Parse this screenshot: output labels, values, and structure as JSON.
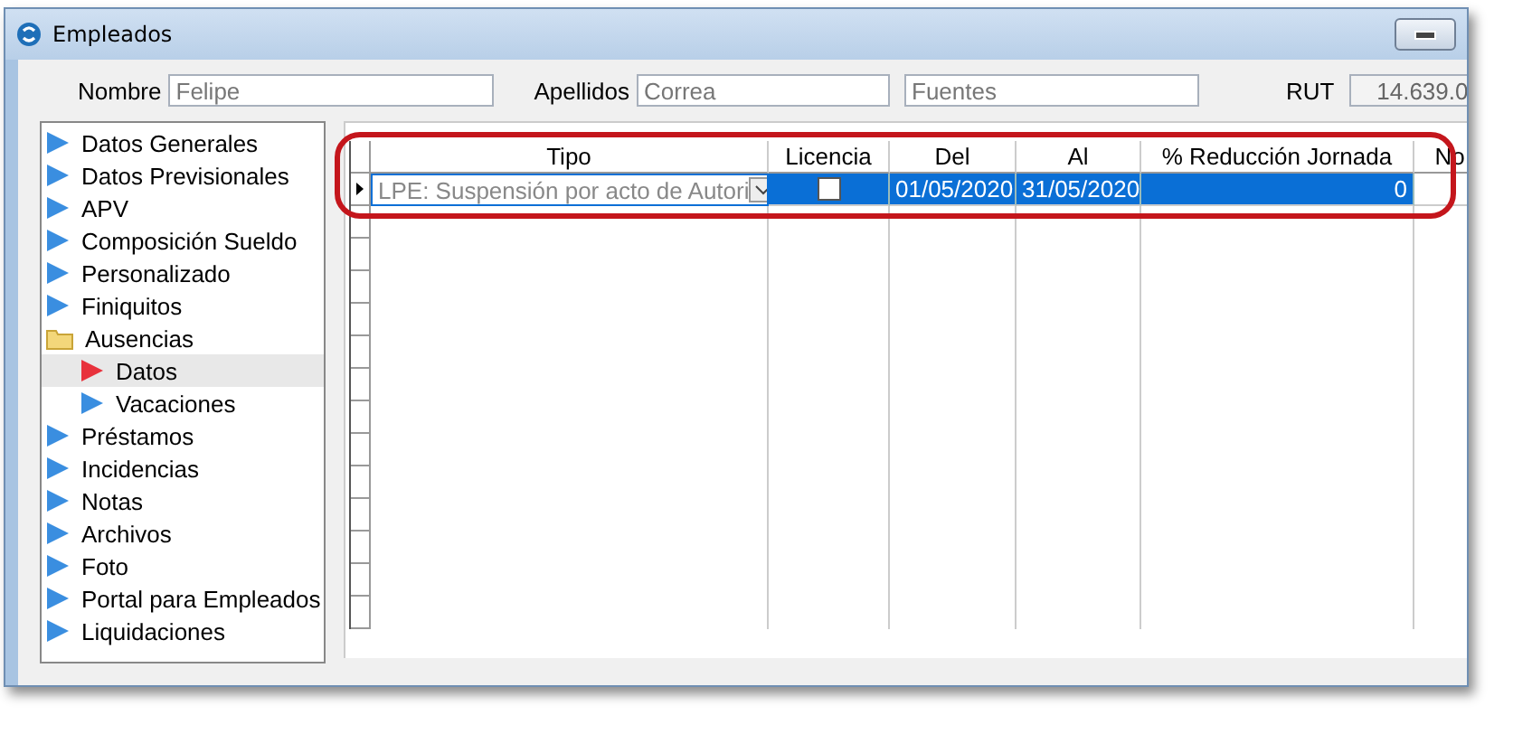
{
  "window": {
    "title": "Empleados"
  },
  "fields": [
    {
      "label": "Nombre",
      "value": "Felipe"
    },
    {
      "label": "Apellidos",
      "value": "Correa",
      "value2": "Fuentes"
    },
    {
      "label": "RUT",
      "value": "14.639.0"
    }
  ],
  "sidebar": {
    "items": [
      {
        "label": "Datos Generales",
        "selected": false
      },
      {
        "label": "Datos Previsionales",
        "selected": false
      },
      {
        "label": "APV",
        "selected": false
      },
      {
        "label": "Composición Sueldo",
        "selected": false
      },
      {
        "label": "Personalizado",
        "selected": false
      },
      {
        "label": "Finiquitos",
        "selected": false
      },
      {
        "label": "Ausencias",
        "selected": false,
        "expanded": true,
        "children": [
          {
            "label": "Datos",
            "selected": true
          },
          {
            "label": "Vacaciones",
            "selected": false
          }
        ]
      },
      {
        "label": "Préstamos",
        "selected": false
      },
      {
        "label": "Incidencias",
        "selected": false
      },
      {
        "label": "Notas",
        "selected": false
      },
      {
        "label": "Archivos",
        "selected": false
      },
      {
        "label": "Foto",
        "selected": false
      },
      {
        "label": "Portal para Empleados",
        "selected": false
      },
      {
        "label": "Liquidaciones",
        "selected": false
      }
    ]
  },
  "table": {
    "columns": [
      "Tipo",
      "Licencia",
      "Del",
      "Al",
      "% Reducción Jornada",
      "No"
    ],
    "rows": [
      {
        "tipo": "LPE: Suspensión por acto de Autori",
        "licencia": false,
        "del": "01/05/2020",
        "al": "31/05/2020",
        "reduccion": "0",
        "selected": true
      }
    ]
  }
}
